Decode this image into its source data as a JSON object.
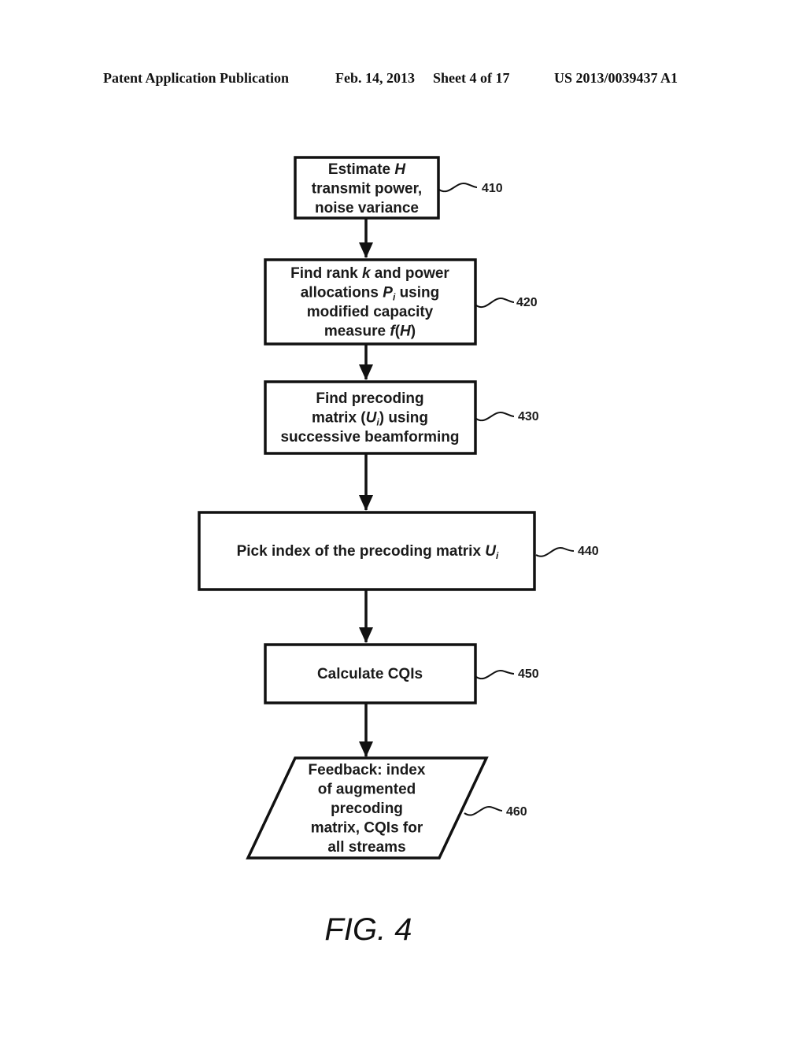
{
  "header": {
    "publication": "Patent Application Publication",
    "date": "Feb. 14, 2013",
    "sheet": "Sheet 4 of 17",
    "number": "US 2013/0039437 A1"
  },
  "steps": [
    {
      "ref": "410",
      "lines": [
        [
          {
            "t": "Estimate "
          },
          {
            "t": "H",
            "i": true
          }
        ],
        [
          {
            "t": "transmit power,"
          }
        ],
        [
          {
            "t": "noise variance"
          }
        ]
      ]
    },
    {
      "ref": "420",
      "lines": [
        [
          {
            "t": "Find rank "
          },
          {
            "t": "k",
            "i": true
          },
          {
            "t": " and power"
          }
        ],
        [
          {
            "t": "allocations "
          },
          {
            "t": "P",
            "i": true
          },
          {
            "t": "i",
            "i": true,
            "sub": true
          },
          {
            "t": " using"
          }
        ],
        [
          {
            "t": "modified capacity"
          }
        ],
        [
          {
            "t": "measure "
          },
          {
            "t": "f",
            "i": true
          },
          {
            "t": "("
          },
          {
            "t": "H",
            "i": true
          },
          {
            "t": ")"
          }
        ]
      ]
    },
    {
      "ref": "430",
      "lines": [
        [
          {
            "t": "Find precoding"
          }
        ],
        [
          {
            "t": "matrix ("
          },
          {
            "t": "U",
            "i": true
          },
          {
            "t": "i",
            "i": true,
            "sub": true
          },
          {
            "t": ") using"
          }
        ],
        [
          {
            "t": "successive beamforming"
          }
        ]
      ]
    },
    {
      "ref": "440",
      "lines": [
        [
          {
            "t": "Pick index of the precoding matrix "
          },
          {
            "t": "U",
            "i": true
          },
          {
            "t": "i",
            "i": true,
            "sub": true
          }
        ]
      ]
    },
    {
      "ref": "450",
      "lines": [
        [
          {
            "t": "Calculate CQIs"
          }
        ]
      ]
    },
    {
      "ref": "460",
      "lines": [
        [
          {
            "t": "Feedback: index"
          }
        ],
        [
          {
            "t": "of augmented"
          }
        ],
        [
          {
            "t": "precoding"
          }
        ],
        [
          {
            "t": "matrix, CQIs for"
          }
        ],
        [
          {
            "t": "all streams"
          }
        ]
      ]
    }
  ],
  "figure_label": "FIG. 4"
}
